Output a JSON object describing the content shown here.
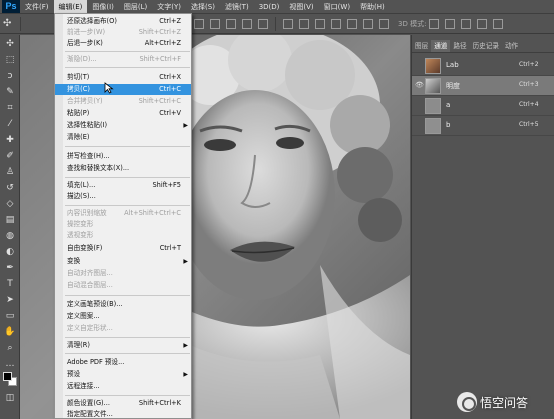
{
  "app": {
    "logo": "Ps"
  },
  "menubar": [
    "文件(F)",
    "编辑(E)",
    "图像(I)",
    "图层(L)",
    "文字(Y)",
    "选择(S)",
    "滤镜(T)",
    "3D(D)",
    "视图(V)",
    "窗口(W)",
    "帮助(H)"
  ],
  "optionsbar": {
    "mode_label": "3D 模式:"
  },
  "edit_menu": [
    {
      "label": "还原选择画布(O)",
      "shortcut": "Ctrl+Z"
    },
    {
      "label": "前进一步(W)",
      "shortcut": "Shift+Ctrl+Z"
    },
    {
      "label": "后退一步(K)",
      "shortcut": "Alt+Ctrl+Z"
    },
    {
      "label": "渐隐(D)...",
      "shortcut": "Shift+Ctrl+F"
    },
    {
      "label": "剪切(T)",
      "shortcut": "Ctrl+X"
    },
    {
      "label": "拷贝(C)",
      "shortcut": "Ctrl+C"
    },
    {
      "label": "合并拷贝(Y)",
      "shortcut": "Shift+Ctrl+C"
    },
    {
      "label": "粘贴(P)",
      "shortcut": "Ctrl+V"
    },
    {
      "label": "选择性粘贴(I)",
      "shortcut": ""
    },
    {
      "label": "清除(E)",
      "shortcut": ""
    },
    {
      "label": "拼写检查(H)...",
      "shortcut": ""
    },
    {
      "label": "查找和替换文本(X)...",
      "shortcut": ""
    },
    {
      "label": "填充(L)...",
      "shortcut": "Shift+F5"
    },
    {
      "label": "描边(S)...",
      "shortcut": ""
    },
    {
      "label": "内容识别缩放",
      "shortcut": "Alt+Shift+Ctrl+C"
    },
    {
      "label": "操控变形",
      "shortcut": ""
    },
    {
      "label": "透视变形",
      "shortcut": ""
    },
    {
      "label": "自由变换(F)",
      "shortcut": "Ctrl+T"
    },
    {
      "label": "变换",
      "shortcut": ""
    },
    {
      "label": "自动对齐图层...",
      "shortcut": ""
    },
    {
      "label": "自动混合图层...",
      "shortcut": ""
    },
    {
      "label": "定义画笔预设(B)...",
      "shortcut": ""
    },
    {
      "label": "定义图案...",
      "shortcut": ""
    },
    {
      "label": "定义自定形状...",
      "shortcut": ""
    },
    {
      "label": "清理(R)",
      "shortcut": ""
    },
    {
      "label": "Adobe PDF 预设...",
      "shortcut": ""
    },
    {
      "label": "预设",
      "shortcut": ""
    },
    {
      "label": "远程连接...",
      "shortcut": ""
    },
    {
      "label": "颜色设置(G)...",
      "shortcut": "Shift+Ctrl+K"
    },
    {
      "label": "指定配置文件...",
      "shortcut": ""
    }
  ],
  "panel": {
    "tabs": [
      "图层",
      "通道",
      "路径",
      "历史记录",
      "动作"
    ],
    "channels": [
      {
        "name": "Lab",
        "shortcut": "Ctrl+2"
      },
      {
        "name": "明度",
        "shortcut": "Ctrl+3"
      },
      {
        "name": "a",
        "shortcut": "Ctrl+4"
      },
      {
        "name": "b",
        "shortcut": "Ctrl+5"
      }
    ]
  },
  "watermark": {
    "text": "悟空问答"
  }
}
